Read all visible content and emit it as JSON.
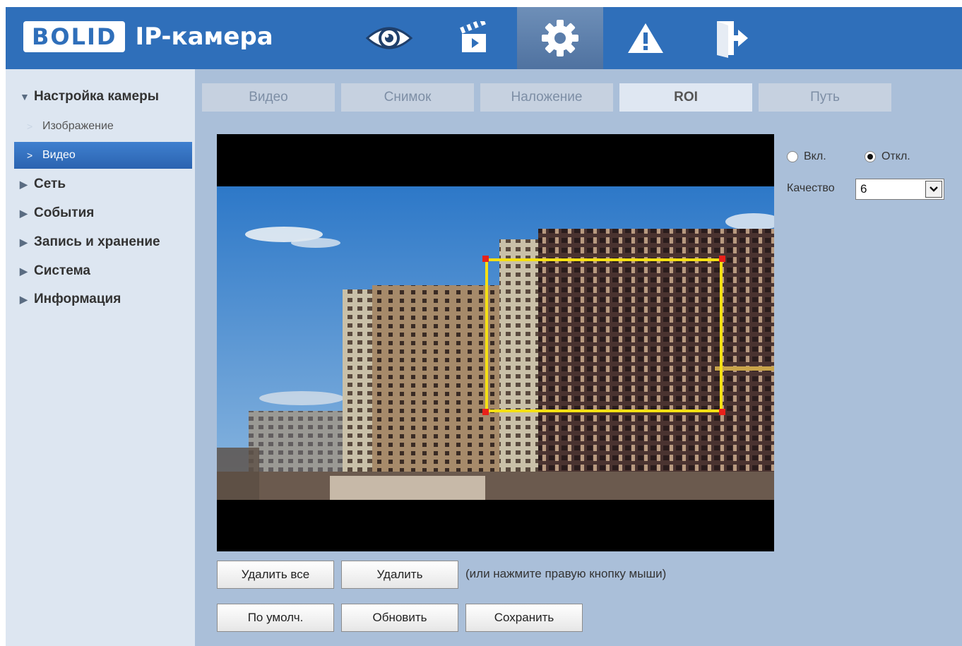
{
  "header": {
    "logo_text": "BOLID",
    "app_title": "IP-камера",
    "nav": [
      {
        "icon": "eye-icon",
        "active": false
      },
      {
        "icon": "clapperboard-icon",
        "active": false
      },
      {
        "icon": "gear-icon",
        "active": true
      },
      {
        "icon": "warning-icon",
        "active": false
      },
      {
        "icon": "logout-icon",
        "active": false
      }
    ],
    "colors": {
      "bar": "#2f6fba",
      "active_tab": "#5a7daa"
    }
  },
  "sidebar": {
    "items": [
      {
        "label": "Настройка камеры",
        "expanded": true
      },
      {
        "label": "Изображение",
        "sub": true
      },
      {
        "label": "Видео",
        "sub": true,
        "active": true
      },
      {
        "label": "Сеть"
      },
      {
        "label": "События"
      },
      {
        "label": "Запись и хранение"
      },
      {
        "label": "Система"
      },
      {
        "label": "Информация"
      }
    ]
  },
  "tabs": [
    {
      "label": "Видео"
    },
    {
      "label": "Снимок"
    },
    {
      "label": "Наложение"
    },
    {
      "label": "ROI",
      "active": true
    },
    {
      "label": "Путь"
    }
  ],
  "roi": {
    "enable_label": "Вкл.",
    "disable_label": "Откл.",
    "selected": "Откл.",
    "quality_label": "Качество",
    "quality_value": "6",
    "region_color": "#f5e013",
    "handle_color": "#e8211a"
  },
  "buttons": {
    "delete_all": "Удалить все",
    "delete": "Удалить",
    "delete_hint": "(или нажмите правую кнопку мыши)",
    "default": "По умолч.",
    "refresh": "Обновить",
    "save": "Сохранить"
  }
}
